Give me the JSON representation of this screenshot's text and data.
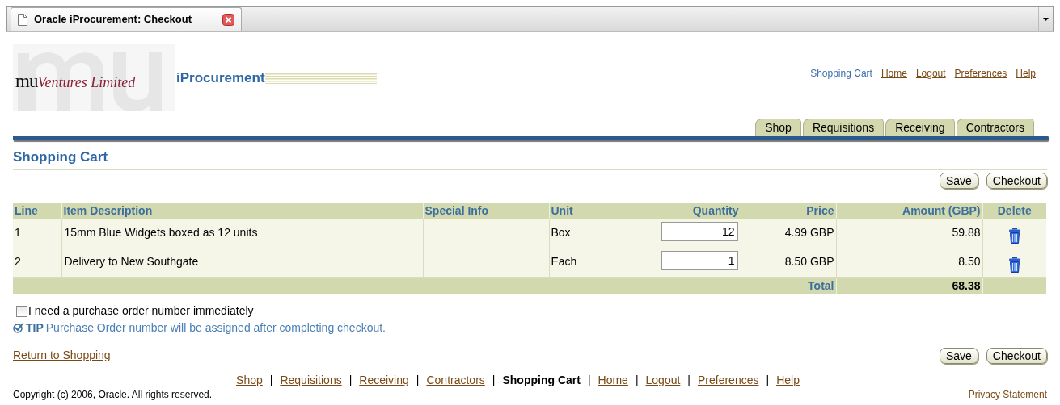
{
  "browser_tab": {
    "title": "Oracle iProcurement: Checkout"
  },
  "logo": {
    "mark": "mu",
    "name": "Ventures Limited",
    "product": "iProcurement"
  },
  "global_links": [
    {
      "label": "Shopping Cart",
      "selected": true
    },
    {
      "label": "Home",
      "selected": false
    },
    {
      "label": "Logout",
      "selected": false
    },
    {
      "label": "Preferences",
      "selected": false
    },
    {
      "label": "Help",
      "selected": false
    }
  ],
  "tabs": [
    {
      "label": "Shop",
      "selected": false
    },
    {
      "label": "Requisitions",
      "selected": false
    },
    {
      "label": "Receiving",
      "selected": false
    },
    {
      "label": "Contractors",
      "selected": false
    }
  ],
  "page_title": "Shopping Cart",
  "buttons": [
    {
      "label": "Save"
    },
    {
      "label": "Checkout"
    }
  ],
  "table": {
    "columns": [
      {
        "label": "Line"
      },
      {
        "label": "Item Description"
      },
      {
        "label": "Special Info"
      },
      {
        "label": "Unit"
      },
      {
        "label": "Quantity"
      },
      {
        "label": "Price"
      },
      {
        "label": "Amount (GBP)"
      },
      {
        "label": "Delete"
      }
    ],
    "rows": [
      {
        "line": "1",
        "description": "15mm Blue Widgets boxed as 12 units",
        "unit": "Box",
        "quantity": "12",
        "price": "4.99 GBP",
        "amount": "59.88"
      },
      {
        "line": "2",
        "description": "Delivery to New Southgate",
        "unit": "Each",
        "quantity": "1",
        "price": "8.50 GBP",
        "amount": "8.50"
      }
    ],
    "total": {
      "label": "Total",
      "value": "68.38"
    }
  },
  "po_checkbox": {
    "label": "I need a purchase order number immediately",
    "checked": false
  },
  "tip": {
    "label": "TIP",
    "text": "Purchase Order number will be assigned after completing checkout."
  },
  "return_link": "Return to Shopping",
  "bottom_buttons": [
    {
      "label": "Save"
    },
    {
      "label": "Checkout"
    }
  ],
  "footer_nav": {
    "separator": "|",
    "items": [
      {
        "label": "Shop",
        "selected": false
      },
      {
        "label": "Requisitions",
        "selected": false
      },
      {
        "label": "Receiving",
        "selected": false
      },
      {
        "label": "Contractors",
        "selected": false
      },
      {
        "label": "Shopping Cart",
        "selected": true
      },
      {
        "label": "Home",
        "selected": false
      },
      {
        "label": "Logout",
        "selected": false
      },
      {
        "label": "Preferences",
        "selected": false
      },
      {
        "label": "Help",
        "selected": false
      }
    ]
  },
  "copyright": "Copyright (c) 2006, Oracle. All rights reserved.",
  "privacy_link": "Privacy Statement"
}
